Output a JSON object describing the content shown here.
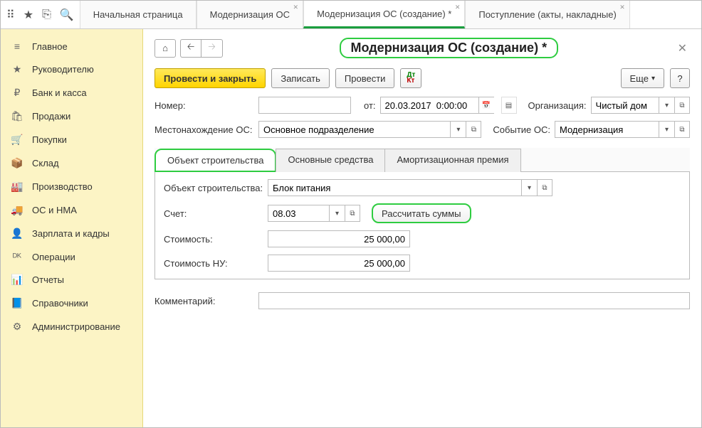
{
  "top_icons": {
    "apps": "apps-icon",
    "star": "star-icon",
    "history": "history-icon",
    "search": "search-icon"
  },
  "tabs": [
    {
      "label": "Начальная страница",
      "closable": false
    },
    {
      "label": "Модернизация ОС",
      "closable": true
    },
    {
      "label": "Модернизация ОС (создание) *",
      "closable": true,
      "active": true
    },
    {
      "label": "Поступление (акты, накладные)",
      "closable": true
    }
  ],
  "sidebar": [
    {
      "icon": "≡",
      "label": "Главное"
    },
    {
      "icon": "★",
      "label": "Руководителю"
    },
    {
      "icon": "₽",
      "label": "Банк и касса"
    },
    {
      "icon": "🛍",
      "label": "Продажи"
    },
    {
      "icon": "🛒",
      "label": "Покупки"
    },
    {
      "icon": "📦",
      "label": "Склад"
    },
    {
      "icon": "🏭",
      "label": "Производство"
    },
    {
      "icon": "🚚",
      "label": "ОС и НМА"
    },
    {
      "icon": "👤",
      "label": "Зарплата и кадры"
    },
    {
      "icon": "ᴰᴷ",
      "label": "Операции"
    },
    {
      "icon": "📊",
      "label": "Отчеты"
    },
    {
      "icon": "📘",
      "label": "Справочники"
    },
    {
      "icon": "⚙",
      "label": "Администрирование"
    }
  ],
  "title": "Модернизация ОС (создание) *",
  "commands": {
    "post_close": "Провести и закрыть",
    "save": "Записать",
    "post": "Провести",
    "more": "Еще",
    "help": "?"
  },
  "fields": {
    "number_label": "Номер:",
    "number_value": "",
    "from_label": "от:",
    "date_value": "20.03.2017  0:00:00",
    "org_label": "Организация:",
    "org_value": "Чистый дом",
    "location_label": "Местонахождение ОС:",
    "location_value": "Основное подразделение",
    "event_label": "Событие ОС:",
    "event_value": "Модернизация",
    "comment_label": "Комментарий:",
    "comment_value": ""
  },
  "inner_tabs": [
    {
      "label": "Объект строительства",
      "active": true
    },
    {
      "label": "Основные средства"
    },
    {
      "label": "Амортизационная премия"
    }
  ],
  "tab1": {
    "obj_label": "Объект строительства:",
    "obj_value": "Блок питания",
    "acct_label": "Счет:",
    "acct_value": "08.03",
    "calc_btn": "Рассчитать суммы",
    "cost_label": "Стоимость:",
    "cost_value": "25 000,00",
    "costnu_label": "Стоимость НУ:",
    "costnu_value": "25 000,00"
  }
}
